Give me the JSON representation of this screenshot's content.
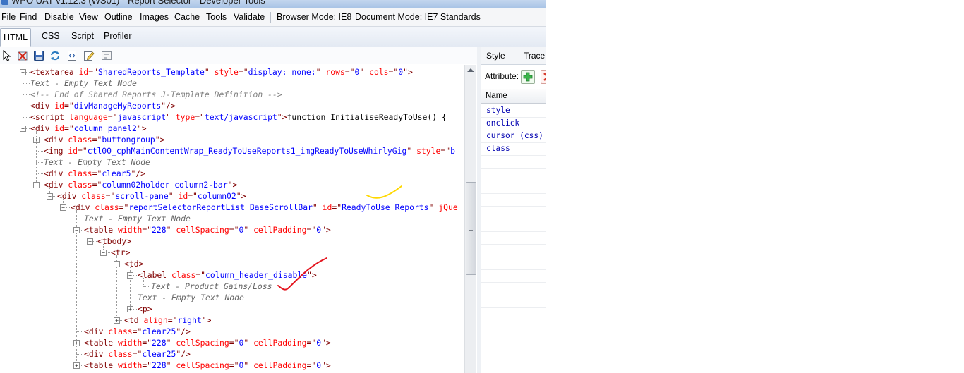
{
  "window": {
    "title": "WPO UAT v1.12.3 (WS01) - Report Selector - Developer Tools"
  },
  "menu": {
    "items": [
      "File",
      "Find",
      "Disable",
      "View",
      "Outline",
      "Images",
      "Cache",
      "Tools",
      "Validate"
    ],
    "browser_mode": "Browser Mode: IE8",
    "document_mode": "Document Mode: IE7 Standards"
  },
  "tabs": [
    "HTML",
    "CSS",
    "Script",
    "Profiler"
  ],
  "toolbar": {
    "icons": [
      "select-element-icon",
      "clear-browser-cache-icon",
      "save-icon",
      "refresh-icon",
      "source-icon",
      "edit-icon",
      "word-wrap-icon"
    ]
  },
  "tree": {
    "lines": [
      {
        "depth": 0,
        "exp": "+",
        "segs": [
          [
            "tag",
            "<textarea "
          ],
          [
            "attr",
            "id"
          ],
          [
            "punct",
            "=\""
          ],
          [
            "val",
            "SharedReports_Template"
          ],
          [
            "punct",
            "\" "
          ],
          [
            "attr",
            "style"
          ],
          [
            "punct",
            "=\""
          ],
          [
            "val",
            "display: none;"
          ],
          [
            "punct",
            "\" "
          ],
          [
            "attr",
            "rows"
          ],
          [
            "punct",
            "=\""
          ],
          [
            "val",
            "0"
          ],
          [
            "punct",
            "\" "
          ],
          [
            "attr",
            "cols"
          ],
          [
            "punct",
            "=\""
          ],
          [
            "val",
            "0"
          ],
          [
            "punct",
            "\">"
          ]
        ]
      },
      {
        "depth": 0,
        "exp": "",
        "segs": [
          [
            "ghost",
            "Text - Empty Text Node"
          ]
        ]
      },
      {
        "depth": 0,
        "exp": "",
        "segs": [
          [
            "cmt",
            "<!--  End of Shared Reports J-Template Definition  -->"
          ]
        ]
      },
      {
        "depth": 0,
        "exp": "",
        "segs": [
          [
            "tag",
            "<div "
          ],
          [
            "attr",
            "id"
          ],
          [
            "punct",
            "=\""
          ],
          [
            "val",
            "divManageMyReports"
          ],
          [
            "punct",
            "\"/>"
          ]
        ]
      },
      {
        "depth": 0,
        "exp": "",
        "segs": [
          [
            "tag",
            "<script "
          ],
          [
            "attr",
            "language"
          ],
          [
            "punct",
            "=\""
          ],
          [
            "val",
            "javascript"
          ],
          [
            "punct",
            "\" "
          ],
          [
            "attr",
            "type"
          ],
          [
            "punct",
            "=\""
          ],
          [
            "val",
            "text/javascript"
          ],
          [
            "punct",
            "\">"
          ],
          [
            "txt",
            "function InitialiseReadyToUse()  {"
          ]
        ]
      },
      {
        "depth": 0,
        "exp": "-",
        "segs": [
          [
            "tag",
            "<div "
          ],
          [
            "attr",
            "id"
          ],
          [
            "punct",
            "=\""
          ],
          [
            "val",
            "column_panel2"
          ],
          [
            "punct",
            "\">"
          ]
        ]
      },
      {
        "depth": 1,
        "exp": "+",
        "segs": [
          [
            "tag",
            "<div "
          ],
          [
            "attr",
            "class"
          ],
          [
            "punct",
            "=\""
          ],
          [
            "val",
            "buttongroup"
          ],
          [
            "punct",
            "\">"
          ]
        ]
      },
      {
        "depth": 1,
        "exp": "",
        "segs": [
          [
            "tag",
            "<img "
          ],
          [
            "attr",
            "id"
          ],
          [
            "punct",
            "=\""
          ],
          [
            "val",
            "ctl00_cphMainContentWrap_ReadyToUseReports1_imgReadyToUseWhirlyGig"
          ],
          [
            "punct",
            "\" "
          ],
          [
            "attr",
            "style"
          ],
          [
            "punct",
            "=\""
          ],
          [
            "val",
            "b"
          ]
        ]
      },
      {
        "depth": 1,
        "exp": "",
        "segs": [
          [
            "ghost",
            "Text - Empty Text Node"
          ]
        ]
      },
      {
        "depth": 1,
        "exp": "",
        "segs": [
          [
            "tag",
            "<div "
          ],
          [
            "attr",
            "class"
          ],
          [
            "punct",
            "=\""
          ],
          [
            "val",
            "clear5"
          ],
          [
            "punct",
            "\"/>"
          ]
        ]
      },
      {
        "depth": 1,
        "exp": "-",
        "segs": [
          [
            "tag",
            "<div "
          ],
          [
            "attr",
            "class"
          ],
          [
            "punct",
            "=\""
          ],
          [
            "val",
            "column02holder column2-bar"
          ],
          [
            "punct",
            "\">"
          ]
        ]
      },
      {
        "depth": 2,
        "exp": "-",
        "segs": [
          [
            "tag",
            "<div "
          ],
          [
            "attr",
            "class"
          ],
          [
            "punct",
            "=\""
          ],
          [
            "val",
            "scroll-pane"
          ],
          [
            "punct",
            "\" "
          ],
          [
            "attr",
            "id"
          ],
          [
            "punct",
            "=\""
          ],
          [
            "val",
            "column02"
          ],
          [
            "punct",
            "\">"
          ]
        ]
      },
      {
        "depth": 3,
        "exp": "-",
        "segs": [
          [
            "tag",
            "<div "
          ],
          [
            "attr",
            "class"
          ],
          [
            "punct",
            "=\""
          ],
          [
            "val",
            "reportSelectorReportList BaseScrollBar"
          ],
          [
            "punct",
            "\" "
          ],
          [
            "attr",
            "id"
          ],
          [
            "punct",
            "=\""
          ],
          [
            "val",
            "ReadyToUse_Reports"
          ],
          [
            "punct",
            "\" "
          ],
          [
            "attr",
            "jQue"
          ]
        ]
      },
      {
        "depth": 4,
        "exp": "",
        "segs": [
          [
            "ghost",
            "Text - Empty Text Node"
          ]
        ]
      },
      {
        "depth": 4,
        "exp": "-",
        "segs": [
          [
            "tag",
            "<table "
          ],
          [
            "attr",
            "width"
          ],
          [
            "punct",
            "=\""
          ],
          [
            "val",
            "228"
          ],
          [
            "punct",
            "\" "
          ],
          [
            "attr",
            "cellSpacing"
          ],
          [
            "punct",
            "=\""
          ],
          [
            "val",
            "0"
          ],
          [
            "punct",
            "\" "
          ],
          [
            "attr",
            "cellPadding"
          ],
          [
            "punct",
            "=\""
          ],
          [
            "val",
            "0"
          ],
          [
            "punct",
            "\">"
          ]
        ]
      },
      {
        "depth": 5,
        "exp": "-",
        "segs": [
          [
            "tag",
            "<tbody>"
          ]
        ]
      },
      {
        "depth": 6,
        "exp": "-",
        "segs": [
          [
            "tag",
            "<tr>"
          ]
        ]
      },
      {
        "depth": 7,
        "exp": "-",
        "segs": [
          [
            "tag",
            "<td>"
          ]
        ]
      },
      {
        "depth": 8,
        "exp": "-",
        "segs": [
          [
            "tag",
            "<label "
          ],
          [
            "attr",
            "class"
          ],
          [
            "punct",
            "=\""
          ],
          [
            "val",
            "column_header_disable"
          ],
          [
            "punct",
            "\">"
          ]
        ]
      },
      {
        "depth": 9,
        "exp": "",
        "segs": [
          [
            "ghost",
            "Text - Product Gains/Loss"
          ]
        ]
      },
      {
        "depth": 8,
        "exp": "",
        "segs": [
          [
            "ghost",
            "Text - Empty Text Node"
          ]
        ]
      },
      {
        "depth": 8,
        "exp": "+",
        "segs": [
          [
            "tag",
            "<p>"
          ]
        ]
      },
      {
        "depth": 7,
        "exp": "+",
        "segs": [
          [
            "tag",
            "<td "
          ],
          [
            "attr",
            "align"
          ],
          [
            "punct",
            "=\""
          ],
          [
            "val",
            "right"
          ],
          [
            "punct",
            "\">"
          ]
        ]
      },
      {
        "depth": 4,
        "exp": "",
        "segs": [
          [
            "tag",
            "<div "
          ],
          [
            "attr",
            "class"
          ],
          [
            "punct",
            "=\""
          ],
          [
            "val",
            "clear25"
          ],
          [
            "punct",
            "\"/>"
          ]
        ]
      },
      {
        "depth": 4,
        "exp": "+",
        "segs": [
          [
            "tag",
            "<table "
          ],
          [
            "attr",
            "width"
          ],
          [
            "punct",
            "=\""
          ],
          [
            "val",
            "228"
          ],
          [
            "punct",
            "\" "
          ],
          [
            "attr",
            "cellSpacing"
          ],
          [
            "punct",
            "=\""
          ],
          [
            "val",
            "0"
          ],
          [
            "punct",
            "\" "
          ],
          [
            "attr",
            "cellPadding"
          ],
          [
            "punct",
            "=\""
          ],
          [
            "val",
            "0"
          ],
          [
            "punct",
            "\">"
          ]
        ]
      },
      {
        "depth": 4,
        "exp": "",
        "segs": [
          [
            "tag",
            "<div "
          ],
          [
            "attr",
            "class"
          ],
          [
            "punct",
            "=\""
          ],
          [
            "val",
            "clear25"
          ],
          [
            "punct",
            "\"/>"
          ]
        ]
      },
      {
        "depth": 4,
        "exp": "+",
        "segs": [
          [
            "tag",
            "<table "
          ],
          [
            "attr",
            "width"
          ],
          [
            "punct",
            "=\""
          ],
          [
            "val",
            "228"
          ],
          [
            "punct",
            "\" "
          ],
          [
            "attr",
            "cellSpacing"
          ],
          [
            "punct",
            "=\""
          ],
          [
            "val",
            "0"
          ],
          [
            "punct",
            "\" "
          ],
          [
            "attr",
            "cellPadding"
          ],
          [
            "punct",
            "=\""
          ],
          [
            "val",
            "0"
          ],
          [
            "punct",
            "\">"
          ]
        ]
      }
    ]
  },
  "right_panel": {
    "tabs": [
      "Style",
      "Trace"
    ],
    "attribute_label": "Attribute:",
    "column_header": "Name",
    "rows": [
      "style",
      "onclick",
      "cursor (css)",
      "class"
    ]
  }
}
